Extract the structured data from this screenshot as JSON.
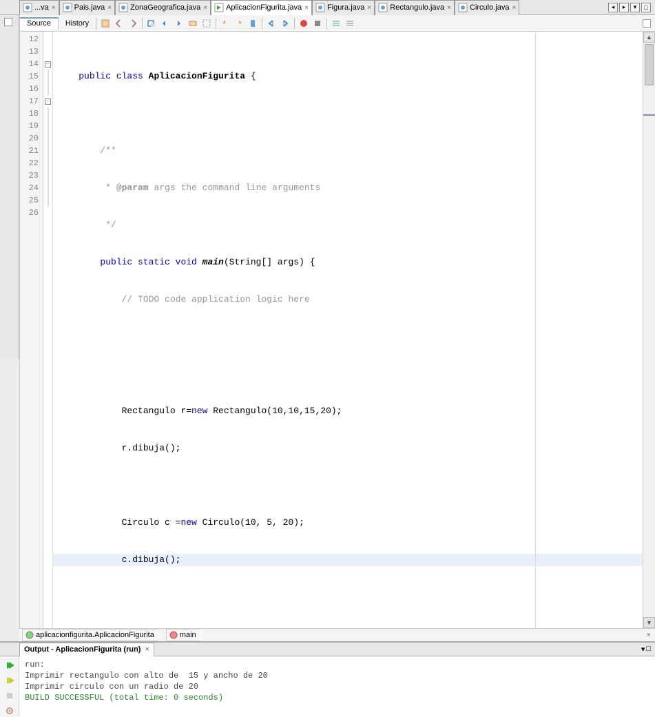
{
  "tabs": [
    {
      "label": "...va",
      "icon": "java"
    },
    {
      "label": "Pais.java",
      "icon": "java"
    },
    {
      "label": "ZonaGeografica.java",
      "icon": "java"
    },
    {
      "label": "AplicacionFigurita.java",
      "icon": "main",
      "active": true
    },
    {
      "label": "Figura.java",
      "icon": "java"
    },
    {
      "label": "Rectangulo.java",
      "icon": "java"
    },
    {
      "label": "Circulo.java",
      "icon": "java"
    }
  ],
  "view_tabs": {
    "source": "Source",
    "history": "History"
  },
  "line_start": 12,
  "line_count": 15,
  "code": {
    "l12": {
      "pre": "    ",
      "kw": "public class ",
      "name": "AplicacionFigurita",
      "rest": " {"
    },
    "l13": "",
    "l14": "        /**",
    "l15_a": "         * ",
    "l15_tag": "@param",
    "l15_b": " ",
    "l15_arg": "args",
    "l15_c": " the command line arguments",
    "l16": "         */",
    "l17_a": "        ",
    "l17_kw": "public static void ",
    "l17_m": "main",
    "l17_b": "(String[] args) {",
    "l18_a": "            ",
    "l18_c": "// TODO code application logic here",
    "l19": "",
    "l20": "",
    "l21_a": "            Rectangulo r=",
    "l21_kw": "new",
    "l21_b": " Rectangulo(10,10,15,20);",
    "l22": "            r.dibuja();",
    "l23": "",
    "l24_a": "            Circulo c =",
    "l24_kw": "new",
    "l24_b": " Circulo(10, 5, 20);",
    "l25": "            c.dibuja();",
    "l26": ""
  },
  "breadcrumbs": [
    {
      "label": "aplicacionfigurita.AplicacionFigurita",
      "icon": "class"
    },
    {
      "label": "main",
      "icon": "method"
    }
  ],
  "output": {
    "title": "Output - AplicacionFigurita (run)",
    "lines": [
      {
        "text": "run:",
        "cls": ""
      },
      {
        "text": "Imprimir rectangulo con alto de  15 y ancho de 20",
        "cls": ""
      },
      {
        "text": "Imprimir circulo con un radio de 20",
        "cls": ""
      },
      {
        "text": "BUILD SUCCESSFUL (total time: 0 seconds)",
        "cls": "success"
      }
    ]
  }
}
